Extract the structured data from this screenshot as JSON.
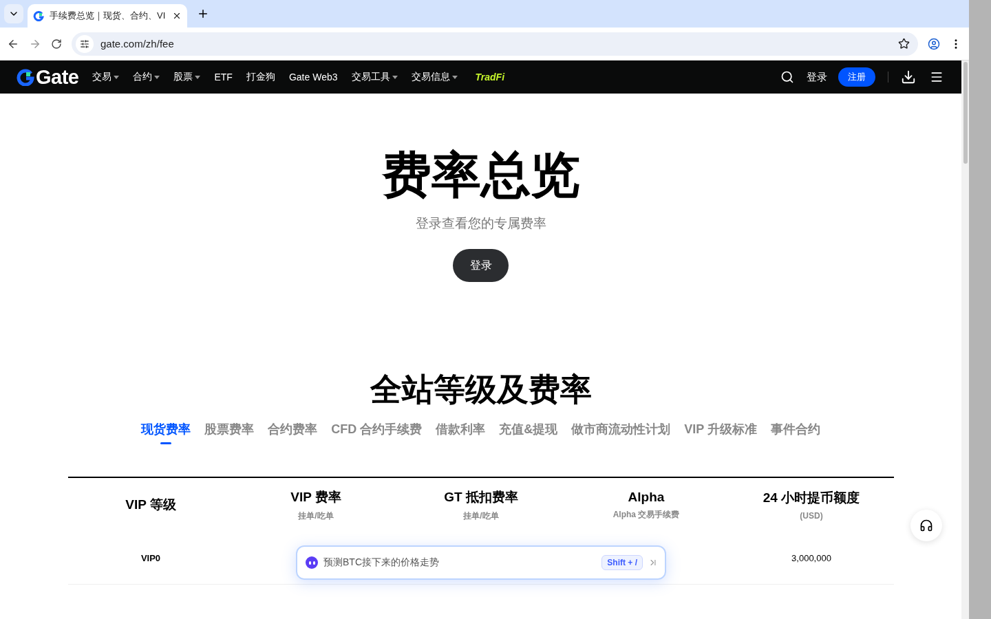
{
  "browser": {
    "tab_title": "手续费总览｜现货、合约、VI",
    "url": "gate.com/zh/fee"
  },
  "nav": {
    "logo": "Gate",
    "items": [
      {
        "label": "交易",
        "dropdown": true
      },
      {
        "label": "合约",
        "dropdown": true
      },
      {
        "label": "股票",
        "dropdown": true
      },
      {
        "label": "ETF",
        "dropdown": false
      },
      {
        "label": "打金狗",
        "dropdown": false
      },
      {
        "label": "Gate Web3",
        "dropdown": false
      },
      {
        "label": "交易工具",
        "dropdown": true
      },
      {
        "label": "交易信息",
        "dropdown": true
      }
    ],
    "tradfi": "TradFi",
    "login": "登录",
    "register": "注册"
  },
  "hero": {
    "title": "费率总览",
    "subtitle": "登录查看您的专属费率",
    "button": "登录"
  },
  "section": {
    "title": "全站等级及费率",
    "tabs": [
      {
        "label": "现货费率",
        "selected": true
      },
      {
        "label": "股票费率",
        "selected": false
      },
      {
        "label": "合约费率",
        "selected": false
      },
      {
        "label": "CFD 合约手续费",
        "selected": false
      },
      {
        "label": "借款利率",
        "selected": false
      },
      {
        "label": "充值&提现",
        "selected": false
      },
      {
        "label": "做市商流动性计划",
        "selected": false
      },
      {
        "label": "VIP 升级标准",
        "selected": false
      },
      {
        "label": "事件合约",
        "selected": false
      }
    ]
  },
  "table": {
    "columns": [
      {
        "title": "VIP 等级"
      },
      {
        "title": "VIP 费率",
        "sub": "挂单/吃单"
      },
      {
        "title": "GT 抵扣费率",
        "sub": "挂单/吃单"
      },
      {
        "title": "Alpha",
        "sub": "Alpha 交易手续费"
      },
      {
        "title": "24 小时提币额度",
        "sub": "(USD)"
      }
    ],
    "rows": [
      {
        "vip_level": "VIP0",
        "withdrawal_limit": "3,000,000"
      }
    ]
  },
  "assistant": {
    "prompt": "预测BTC接下来的价格走势",
    "shortcut": "Shift + /"
  }
}
